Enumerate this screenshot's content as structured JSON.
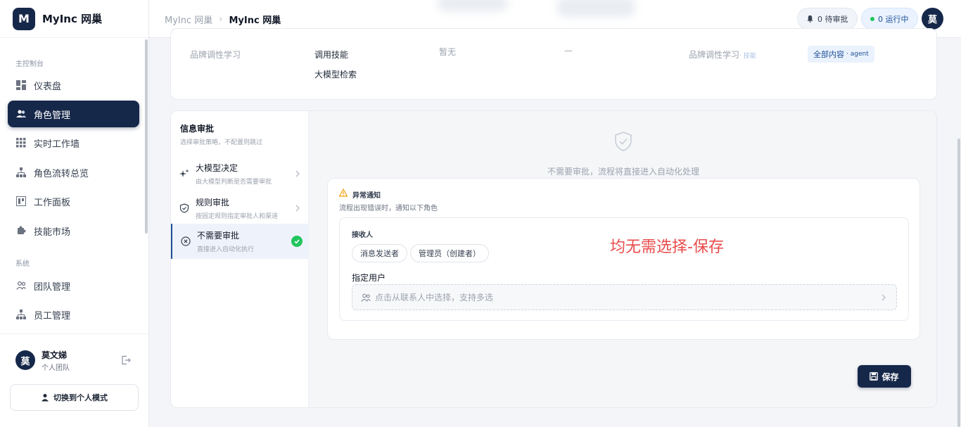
{
  "brand": {
    "logo_letter": "M",
    "name": "MyInc 网巢"
  },
  "sidebar": {
    "section_main": "主控制台",
    "section_system": "系统",
    "items": [
      {
        "label": "仪表盘",
        "icon": "dashboard-icon"
      },
      {
        "label": "角色管理",
        "icon": "users-icon",
        "active": true
      },
      {
        "label": "实时工作墙",
        "icon": "grid-icon"
      },
      {
        "label": "角色流转总览",
        "icon": "flow-icon"
      },
      {
        "label": "工作面板",
        "icon": "board-icon"
      },
      {
        "label": "技能市场",
        "icon": "puzzle-icon"
      }
    ],
    "system_items": [
      {
        "label": "团队管理",
        "icon": "team-icon"
      },
      {
        "label": "员工管理",
        "icon": "org-icon"
      }
    ],
    "user": {
      "avatar": "莫",
      "name": "莫文娣",
      "team": "个人团队"
    },
    "switch_label": "切换到个人模式"
  },
  "topbar": {
    "breadcrumb_root": "MyInc 网巢",
    "breadcrumb_current": "MyInc 网巢",
    "pending_label": "0 待审批",
    "running_label": "0 运行中",
    "avatar": "莫"
  },
  "upper_card": {
    "col1": "品牌调性学习",
    "col2_line1": "调用技能",
    "col2_line2": "大模型检索",
    "col3": "暂无",
    "col4": "—",
    "col5": "品牌调性学习",
    "col5_suffix": "· 技能",
    "tag": "全部内容",
    "tag_suffix": "· agent"
  },
  "approval": {
    "title": "信息审批",
    "subtitle": "选择审批策略，不配置则跳过",
    "options": [
      {
        "title": "大模型决定",
        "subtitle": "由大模型判断是否需要审批",
        "icon": "sparkle-icon"
      },
      {
        "title": "规则审批",
        "subtitle": "按固定规则指定审批人和渠道",
        "icon": "shield-icon"
      },
      {
        "title": "不需要审批",
        "subtitle": "直接进入自动化执行",
        "icon": "circle-x-icon",
        "selected": true
      }
    ],
    "empty_message": "不需要审批，流程将直接进入自动化处理"
  },
  "exception_notify": {
    "title": "异常通知",
    "subtitle": "流程出现错误时，通知以下角色",
    "recipients_label": "接收人",
    "recipients": [
      "消息发送者",
      "管理员（创建者）"
    ],
    "users_label": "指定用户",
    "users_placeholder": "点击从联系人中选择，支持多选",
    "annotation": "均无需选择-保存"
  },
  "save_label": "保存",
  "colors": {
    "primary": "#16284a",
    "success": "#22c55e",
    "annotation": "#e94b4b"
  }
}
